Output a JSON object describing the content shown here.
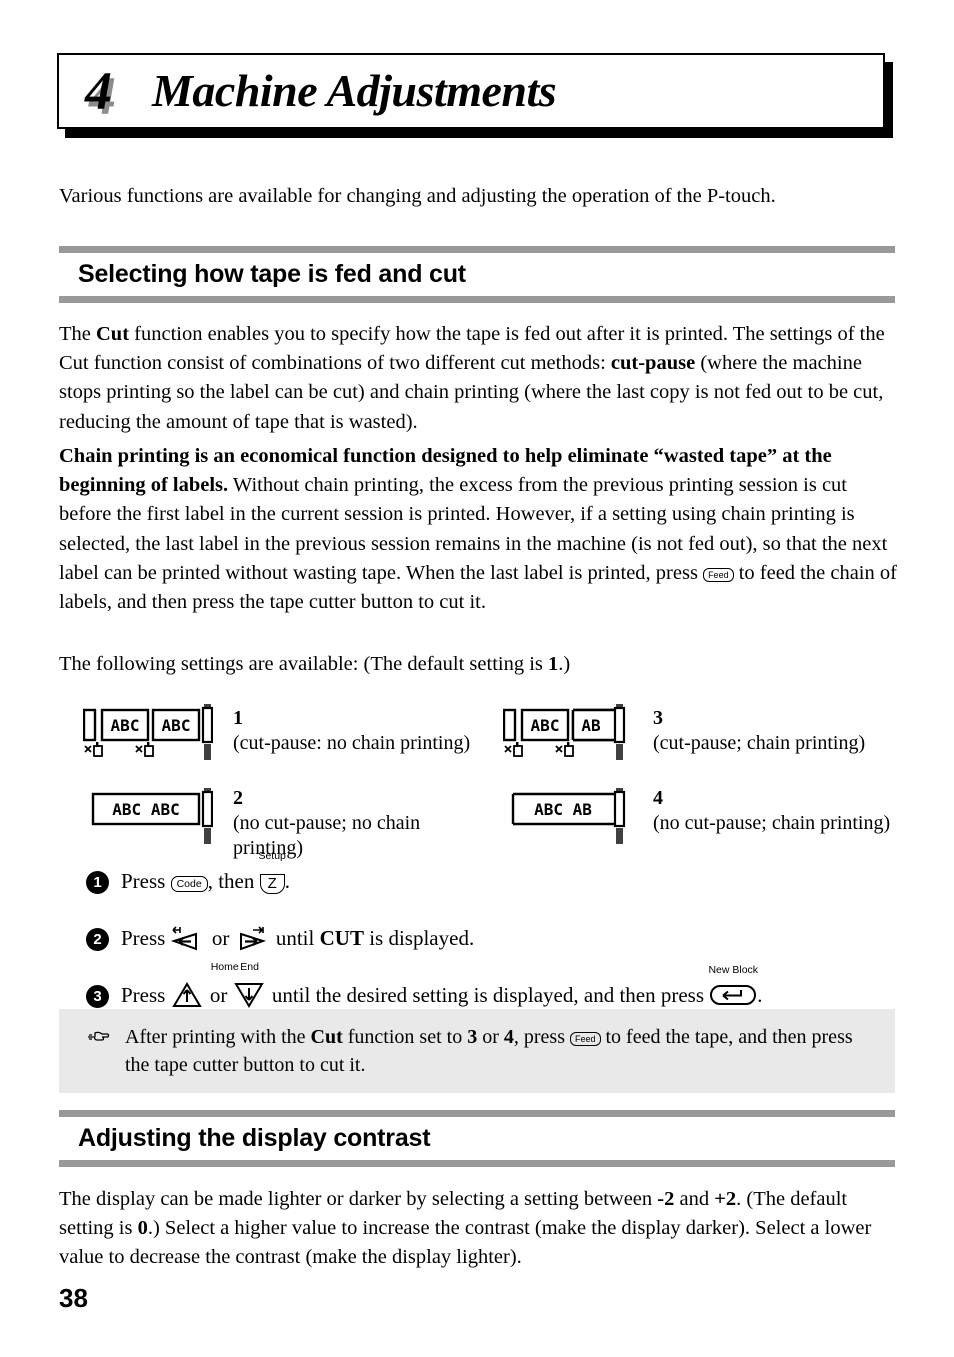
{
  "chapter": {
    "number": "4",
    "title": "Machine Adjustments"
  },
  "intro": "Various functions are available for changing and adjusting the operation of the P-touch.",
  "sections": [
    {
      "title": "Selecting how tape is fed and cut"
    },
    {
      "title": "Adjusting the display contrast"
    }
  ],
  "paragraphs": {
    "cut_intro_1": "The ",
    "cut_intro_bold_1": "Cut",
    "cut_intro_2": " function enables you to specify how the tape is fed out after it is printed. The settings of the Cut function consist of combinations of two different cut methods: ",
    "cut_intro_bold_2": "cut-pause",
    "cut_intro_3": " (where the machine stops printing so the label can be cut) and chain printing (where the last copy is not fed out to be cut, reducing the amount of tape that is wasted).",
    "chain_bold": "Chain printing is an economical function designed to help eliminate “wasted tape” at the beginning of labels.",
    "chain_rest_1": " Without chain printing, the excess from the previous printing session is cut before the first label in the current session is printed. However, if a setting using chain printing is selected, the last label in the previous session remains in the machine (is not fed out), so that the next label can be printed without wasting tape. When the last label is printed, press ",
    "chain_rest_2": " to feed the chain of labels, and then press the tape cutter button to cut it.",
    "settings_lead_1": "The following settings are available: (The default setting is ",
    "settings_lead_bold": "1",
    "settings_lead_2": ".)",
    "contrast_1": "The display can be made lighter or darker by selecting a setting between ",
    "contrast_bold_1": "-2",
    "contrast_2": " and ",
    "contrast_bold_2": "+2",
    "contrast_3": ". (The default setting is ",
    "contrast_bold_3": "0",
    "contrast_4": ".) Select a higher value to increase the contrast (make the display darker). Select a lower value to decrease the contrast (make the display lighter)."
  },
  "diagrams": [
    {
      "number": "1",
      "caption": "(cut-pause: no chain printing)",
      "style": "separate-cut",
      "labels": [
        "ABC",
        "ABC"
      ],
      "truncated": false,
      "cut_marks": 2
    },
    {
      "number": "3",
      "caption": "(cut-pause; chain printing)",
      "style": "separate-cut",
      "labels": [
        "ABC",
        "AB"
      ],
      "truncated": true,
      "cut_marks": 2
    },
    {
      "number": "2",
      "caption": "(no cut-pause; no chain printing)",
      "style": "continuous",
      "labels": [
        "ABC ABC"
      ],
      "truncated": false,
      "cut_marks": 0
    },
    {
      "number": "4",
      "caption": "(no cut-pause; chain printing)",
      "style": "continuous",
      "labels": [
        "ABC AB"
      ],
      "truncated": true,
      "cut_marks": 0
    }
  ],
  "steps": [
    {
      "bullet": "1",
      "pre": "Press ",
      "key1": "Code",
      "key1_label": "",
      "mid": ", then ",
      "key2": "Z",
      "key2_label": "Setup",
      "post": "."
    },
    {
      "bullet": "2",
      "pre": "Press ",
      "key1": "left-arrow",
      "key1_label": "",
      "mid": " or ",
      "key2": "right-arrow",
      "key2_label": "",
      "post_pre": " until ",
      "post_bold": "CUT",
      "post": " is displayed."
    },
    {
      "bullet": "3",
      "pre": "Press ",
      "key1": "up-arrow",
      "key1_label": "Home",
      "mid": " or ",
      "key2": "down-arrow",
      "key2_label": "End",
      "post_pre": " until the desired setting is displayed, and then press ",
      "key3": "enter",
      "key3_label": "New Block",
      "post": "."
    }
  ],
  "note": {
    "icon": "pointing-hand-icon",
    "text_1": "After printing with the ",
    "bold_1": "Cut",
    "text_2": " function set to ",
    "bold_2": "3",
    "text_3": " or ",
    "bold_3": "4",
    "text_4": ", press ",
    "feed_key": "Feed",
    "text_5": " to feed the tape, and then press the tape cutter button to cut it."
  },
  "page_number": "38",
  "colors": {
    "rule_gray": "#999999",
    "note_background": "#e9e9e9",
    "shadow_gray": "#8c8c8c",
    "ink": "#000000"
  }
}
